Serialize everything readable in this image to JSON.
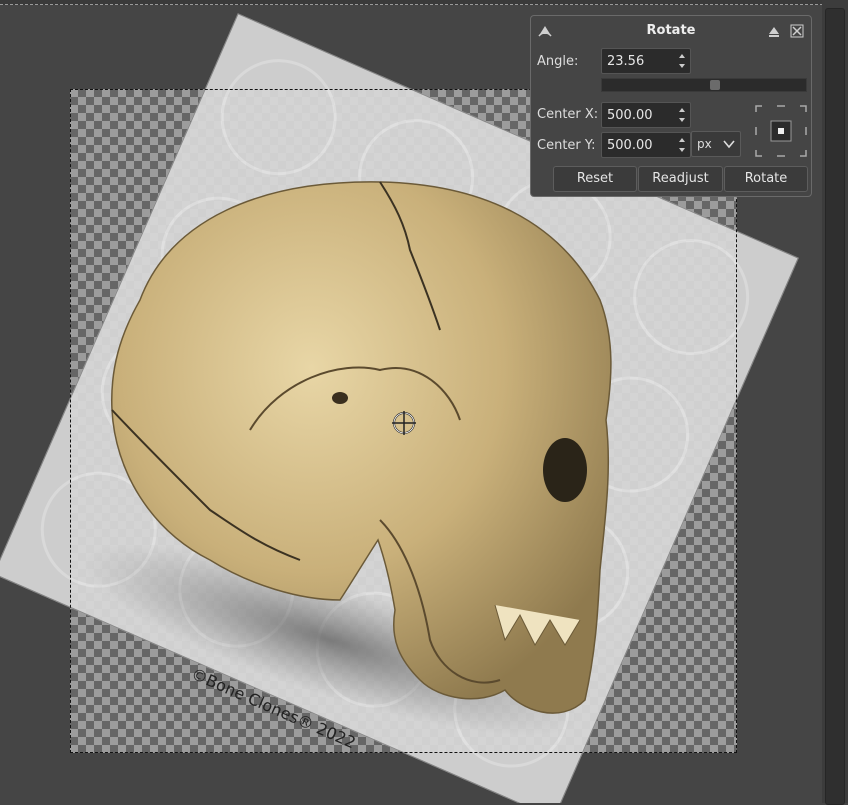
{
  "canvas": {
    "credit_text": "©Bone Clones® 2022"
  },
  "dialog": {
    "title": "Rotate",
    "angle_label": "Angle:",
    "angle_value": "23.56",
    "center_x_label": "Center X:",
    "center_x_value": "500.00",
    "center_y_label": "Center Y:",
    "center_y_value": "500.00",
    "unit": "px",
    "buttons": {
      "reset": "Reset",
      "readjust": "Readjust",
      "rotate": "Rotate"
    }
  },
  "icons": {
    "dialog_tool": "rotate-tool-icon",
    "detach": "detach-icon",
    "close": "close-icon",
    "crosshair": "pivot-crosshair-icon",
    "chain": "chain-link-icon"
  }
}
